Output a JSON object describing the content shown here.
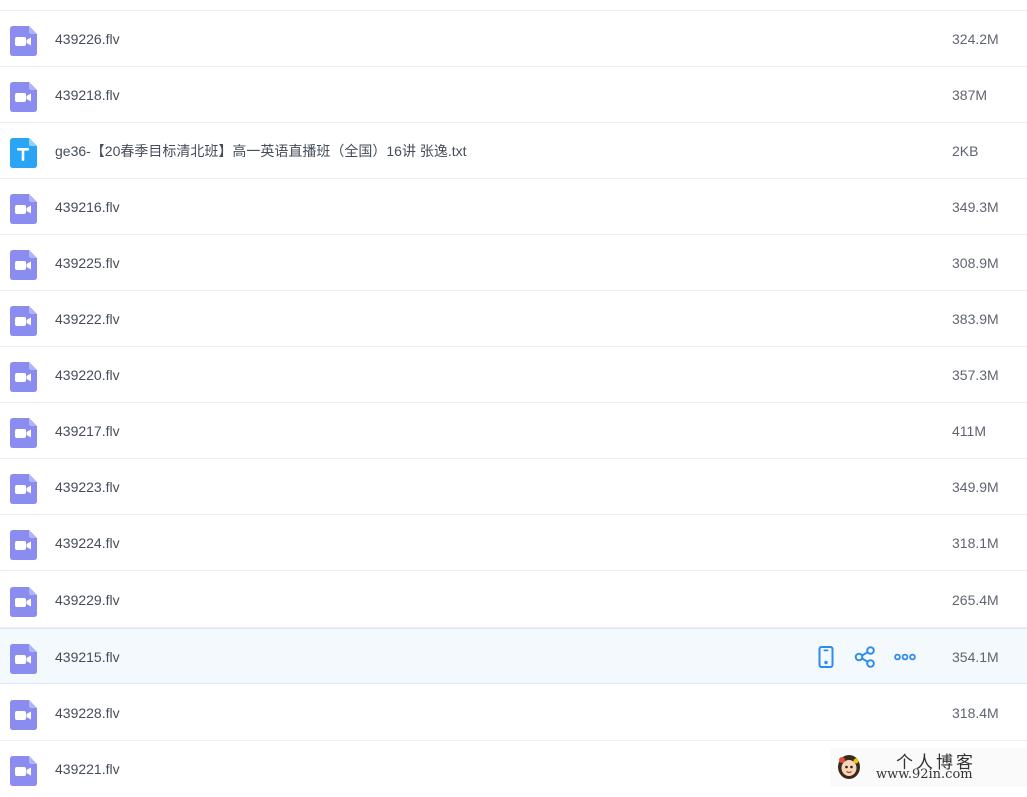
{
  "files": [
    {
      "name": "439226.flv",
      "size": "324.2M",
      "type": "video"
    },
    {
      "name": "439218.flv",
      "size": "387M",
      "type": "video"
    },
    {
      "name": "ge36-【20春季目标清北班】高一英语直播班（全国）16讲 张逸.txt",
      "size": "2KB",
      "type": "text"
    },
    {
      "name": "439216.flv",
      "size": "349.3M",
      "type": "video"
    },
    {
      "name": "439225.flv",
      "size": "308.9M",
      "type": "video"
    },
    {
      "name": "439222.flv",
      "size": "383.9M",
      "type": "video"
    },
    {
      "name": "439220.flv",
      "size": "357.3M",
      "type": "video"
    },
    {
      "name": "439217.flv",
      "size": "411M",
      "type": "video"
    },
    {
      "name": "439223.flv",
      "size": "349.9M",
      "type": "video"
    },
    {
      "name": "439224.flv",
      "size": "318.1M",
      "type": "video"
    },
    {
      "name": "439229.flv",
      "size": "265.4M",
      "type": "video"
    },
    {
      "name": "439215.flv",
      "size": "354.1M",
      "type": "video",
      "hovered": true
    },
    {
      "name": "439228.flv",
      "size": "318.4M",
      "type": "video"
    },
    {
      "name": "439221.flv",
      "size": "",
      "type": "video"
    }
  ],
  "row_actions": {
    "icons": [
      "phone-icon",
      "share-icon",
      "more-icon"
    ]
  },
  "watermark": {
    "title": "个人博客",
    "url": "www.92in.com"
  },
  "colors": {
    "video_icon": "#8b8cf0",
    "text_icon": "#2aa4f4",
    "action_icon": "#2d8cf0",
    "hover_bg": "#f4f9fe"
  }
}
